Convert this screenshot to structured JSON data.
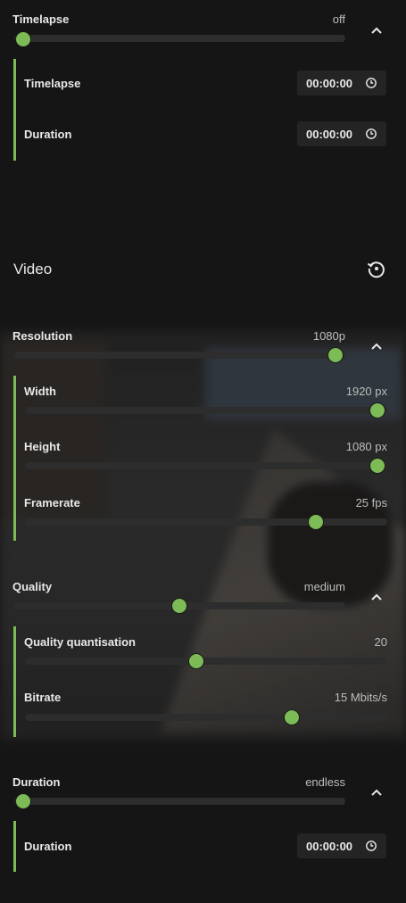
{
  "timelapse": {
    "label": "Timelapse",
    "value": "off",
    "slider_fraction": 0.0,
    "sub": [
      {
        "label": "Timelapse",
        "time": "00:00:00"
      },
      {
        "label": "Duration",
        "time": "00:00:00"
      }
    ]
  },
  "video": {
    "title": "Video",
    "reset_icon": "reset-icon",
    "resolution": {
      "label": "Resolution",
      "value": "1080p",
      "slider_fraction": 1.0,
      "sub": [
        {
          "label": "Width",
          "value": "1920 px",
          "slider_fraction": 1.0
        },
        {
          "label": "Height",
          "value": "1080 px",
          "slider_fraction": 1.0
        },
        {
          "label": "Framerate",
          "value": "25 fps",
          "slider_fraction": 0.8
        }
      ]
    },
    "quality": {
      "label": "Quality",
      "value": "medium",
      "slider_fraction": 0.5,
      "sub": [
        {
          "label": "Quality quantisation",
          "value": "20",
          "slider_fraction": 0.47
        },
        {
          "label": "Bitrate",
          "value": "15 Mbits/s",
          "slider_fraction": 0.74
        }
      ]
    },
    "duration": {
      "label": "Duration",
      "value": "endless",
      "slider_fraction": 0.0,
      "sub": [
        {
          "label": "Duration",
          "time": "00:00:00"
        }
      ]
    }
  },
  "colors": {
    "accent": "#7cbb55",
    "background": "#151515",
    "track": "#2d2d2d"
  }
}
